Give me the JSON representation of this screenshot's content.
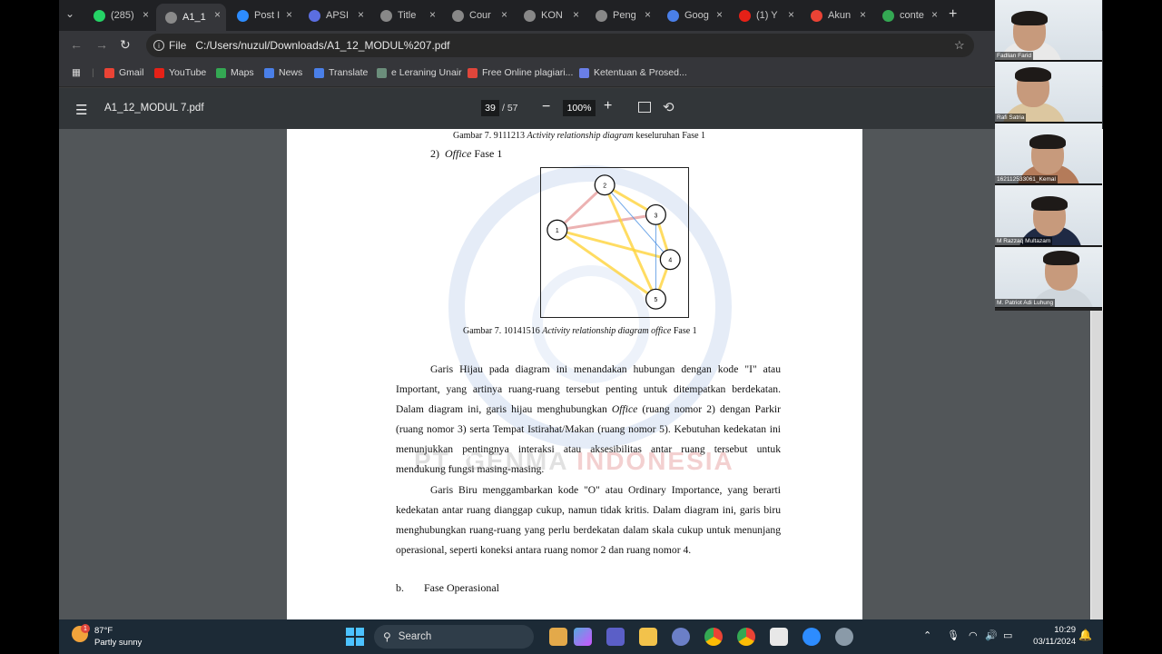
{
  "browser": {
    "tabs": [
      {
        "label": "(285)",
        "icon": "whatsapp-icon",
        "color": "#25d366"
      },
      {
        "label": "A1_1",
        "icon": "globe-icon",
        "color": "#8a8a8a",
        "active": true
      },
      {
        "label": "Post I",
        "icon": "zoom-icon",
        "color": "#2d8cff"
      },
      {
        "label": "APSI",
        "icon": "shield-icon",
        "color": "#5b6ee1"
      },
      {
        "label": "Title",
        "icon": "notion-icon",
        "color": "#888"
      },
      {
        "label": "Cour",
        "icon": "course-icon",
        "color": "#888"
      },
      {
        "label": "KON",
        "icon": "globe-icon",
        "color": "#888"
      },
      {
        "label": "Peng",
        "icon": "globe-icon",
        "color": "#888"
      },
      {
        "label": "Goog",
        "icon": "google-docs-icon",
        "color": "#4a7fe8"
      },
      {
        "label": "(1) Y",
        "icon": "youtube-icon",
        "color": "#e62117"
      },
      {
        "label": "Akun",
        "icon": "gmail-icon",
        "color": "#ea4335"
      },
      {
        "label": "conte",
        "icon": "google-icon",
        "color": "#34a853"
      }
    ],
    "address": {
      "scheme_label": "File",
      "url": "C:/Users/nuzul/Downloads/A1_12_MODUL%207.pdf"
    },
    "bookmarks": [
      {
        "label": "Gmail",
        "icon": "gmail-icon",
        "color": "#ea4335"
      },
      {
        "label": "YouTube",
        "icon": "youtube-icon",
        "color": "#e62117"
      },
      {
        "label": "Maps",
        "icon": "maps-icon",
        "color": "#34a853"
      },
      {
        "label": "News",
        "icon": "news-icon",
        "color": "#4a7fe8"
      },
      {
        "label": "Translate",
        "icon": "translate-icon",
        "color": "#4a7fe8"
      },
      {
        "label": "e Leraning Unair",
        "icon": "elearning-icon",
        "color": "#6b8e7b"
      },
      {
        "label": "Free Online plagiari...",
        "icon": "checkmark-icon",
        "color": "#e0463b"
      },
      {
        "label": "Ketentuan & Prosed...",
        "icon": "wordpress-icon",
        "color": "#6a7fe8"
      }
    ]
  },
  "pdf": {
    "title": "A1_12_MODUL 7.pdf",
    "page_current": "39",
    "page_total": "/  57",
    "zoom": "100%",
    "content": {
      "caption_top_prefix": "Gambar 7. 9111213 ",
      "caption_top_italic": "Activity relationship diagram",
      "caption_top_suffix": " keseluruhan Fase 1",
      "item_number": "2)",
      "item_italic": "Office",
      "item_suffix": " Fase 1",
      "diagram_nodes": [
        "1",
        "2",
        "3",
        "4",
        "5"
      ],
      "caption_prefix": "Gambar 7. 10141516 ",
      "caption_italic": "Activity relationship diagram office",
      "caption_suffix": " Fase 1",
      "para1_a": "Garis Hijau pada diagram ini menandakan hubungan dengan kode \"I\" atau Important, yang artinya ruang-ruang tersebut penting untuk ditempatkan berdekatan. Dalam diagram ini, garis hijau menghubungkan ",
      "para1_italic": "Office",
      "para1_b": " (ruang nomor 2) dengan Parkir (ruang nomor 3) serta Tempat Istirahat/Makan (ruang nomor 5). Kebutuhan kedekatan ini menunjukkan pentingnya interaksi atau aksesibilitas antar ruang tersebut untuk mendukung fungsi masing-masing.",
      "para2": "Garis Biru menggambarkan kode \"O\" atau Ordinary Importance, yang berarti kedekatan antar ruang dianggap cukup, namun tidak kritis. Dalam diagram ini, garis biru menghubungkan ruang-ruang yang perlu berdekatan dalam skala cukup untuk menunjang operasional, seperti koneksi antara ruang nomor 2 dan ruang nomor 4.",
      "heading_letter": "b.",
      "heading_text": "Fase Operasional",
      "watermark_gray": "PT. GENMA ",
      "watermark_red": "INDONESIA"
    }
  },
  "participants": [
    {
      "name": "Fadlian Farid"
    },
    {
      "name": "Rafi Satria"
    },
    {
      "name": "162112533061_Kemal"
    },
    {
      "name": "M Razzaq Multazam"
    },
    {
      "name": "M. Patriot Adi Luhung"
    }
  ],
  "taskbar": {
    "weather_temp": "87°F",
    "weather_cond": "Partly sunny",
    "weather_badge": "1",
    "search_label": "Search",
    "time": "10:29",
    "date": "03/11/2024"
  },
  "colors": {
    "important_line": "#ffd43b",
    "ordinary_line": "#4a90e2",
    "other_line": "#e8a0a0"
  }
}
